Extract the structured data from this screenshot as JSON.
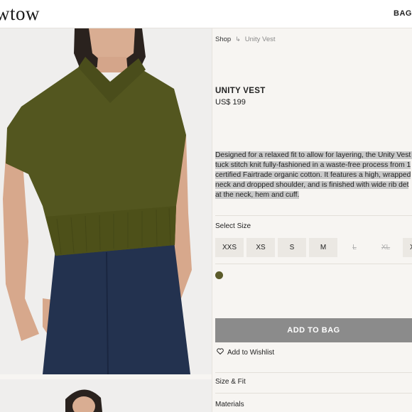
{
  "header": {
    "logo": "wtow",
    "bag_label": "BAG ("
  },
  "breadcrumb": {
    "shop": "Shop",
    "current": "Unity Vest"
  },
  "product": {
    "title": "UNITY VEST",
    "price": "US$ 199",
    "description_lines": [
      "Designed for a relaxed fit to allow for layering, the Unity Vest is",
      "tuck stitch knit fully-fashioned in a waste-free process from 1",
      "certified Fairtrade organic cotton. It features a high, wrapped",
      "neck and dropped shoulder, and is finished with wide rib det",
      "at the neck, hem and cuff."
    ],
    "color": "#5b5b2a"
  },
  "size_selector": {
    "label": "Select Size",
    "options": [
      {
        "label": "XXS",
        "available": true
      },
      {
        "label": "XS",
        "available": true
      },
      {
        "label": "S",
        "available": true
      },
      {
        "label": "M",
        "available": true
      },
      {
        "label": "L",
        "available": false
      },
      {
        "label": "XL",
        "available": false
      },
      {
        "label": "X",
        "available": true
      }
    ]
  },
  "actions": {
    "add_to_bag": "ADD TO BAG",
    "wishlist": "Add to Wishlist"
  },
  "accordion": {
    "size_fit": "Size & Fit",
    "materials": "Materials"
  }
}
